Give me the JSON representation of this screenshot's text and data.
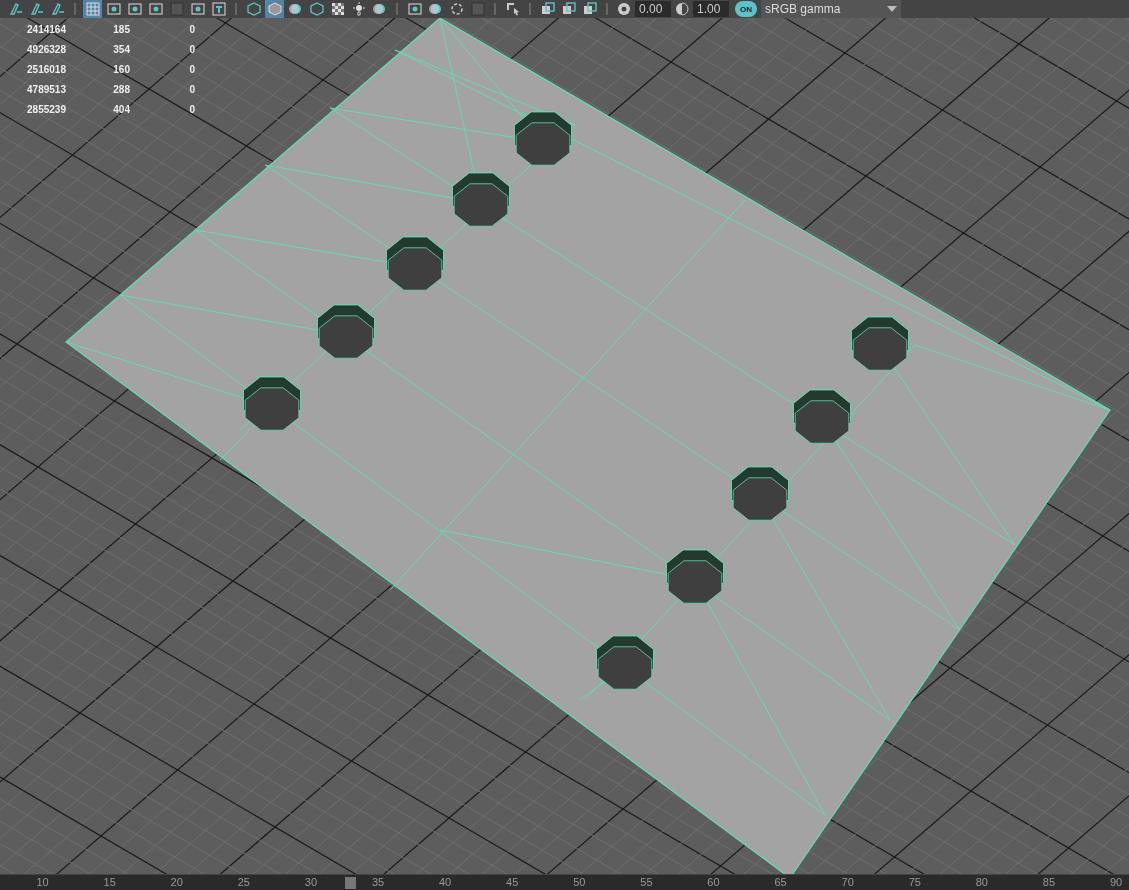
{
  "toolbar": {
    "buttons": [
      {
        "selected": false
      },
      {
        "selected": false
      },
      {
        "selected": false
      },
      {
        "selected": true
      },
      {
        "selected": false
      },
      {
        "selected": false
      },
      {
        "selected": false
      },
      {
        "selected": false
      },
      {
        "selected": false
      },
      {
        "selected": false
      },
      {
        "selected": false
      },
      {
        "selected": true
      },
      {
        "selected": false
      },
      {
        "selected": false
      },
      {
        "selected": false
      },
      {
        "selected": false
      },
      {
        "selected": false
      },
      {
        "selected": false
      },
      {
        "selected": false
      },
      {
        "selected": false
      },
      {
        "selected": false
      },
      {
        "selected": false
      },
      {
        "selected": false
      },
      {
        "selected": false
      },
      {
        "selected": false
      }
    ],
    "exposure": {
      "value": "0.00"
    },
    "gamma": {
      "value": "1.00"
    },
    "view_transform": {
      "on": true,
      "label": "ON",
      "value": "sRGB gamma"
    }
  },
  "hud_stats": {
    "rows": [
      [
        "2414164",
        "185",
        "0"
      ],
      [
        "4926328",
        "354",
        "0"
      ],
      [
        "2516018",
        "160",
        "0"
      ],
      [
        "4789513",
        "288",
        "0"
      ],
      [
        "2855239",
        "404",
        "0"
      ]
    ]
  },
  "timeline": {
    "level": 0.31,
    "ticks": [
      "10",
      "15",
      "20",
      "25",
      "30",
      "35",
      "40",
      "45",
      "50",
      "55",
      "60",
      "65",
      "70",
      "75",
      "80",
      "85",
      "90"
    ]
  }
}
